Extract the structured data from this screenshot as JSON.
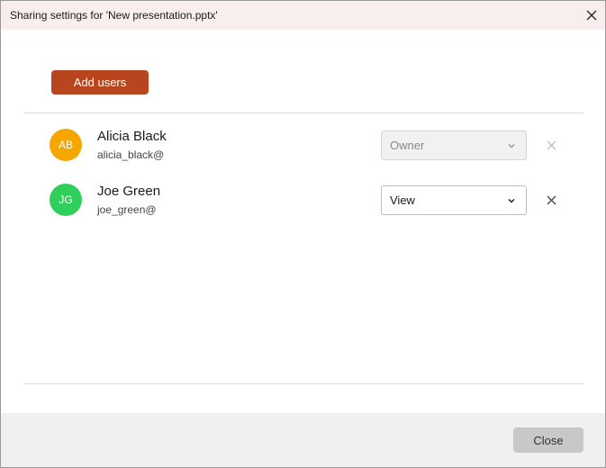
{
  "dialog": {
    "title": "Sharing settings for 'New presentation.pptx'",
    "close_icon": "close-icon"
  },
  "actions": {
    "add_users_label": "Add users"
  },
  "users": [
    {
      "initials": "AB",
      "name": "Alicia Black",
      "email": "alicia_black@",
      "avatar_color": "#f5a700",
      "role": "Owner",
      "role_disabled": true
    },
    {
      "initials": "JG",
      "name": "Joe Green",
      "email": "joe_green@",
      "avatar_color": "#2fcf5c",
      "role": "View",
      "role_disabled": false
    }
  ],
  "footer": {
    "close_label": "Close"
  },
  "colors": {
    "accent": "#b7461f",
    "title_bar": "#f8eeee"
  }
}
